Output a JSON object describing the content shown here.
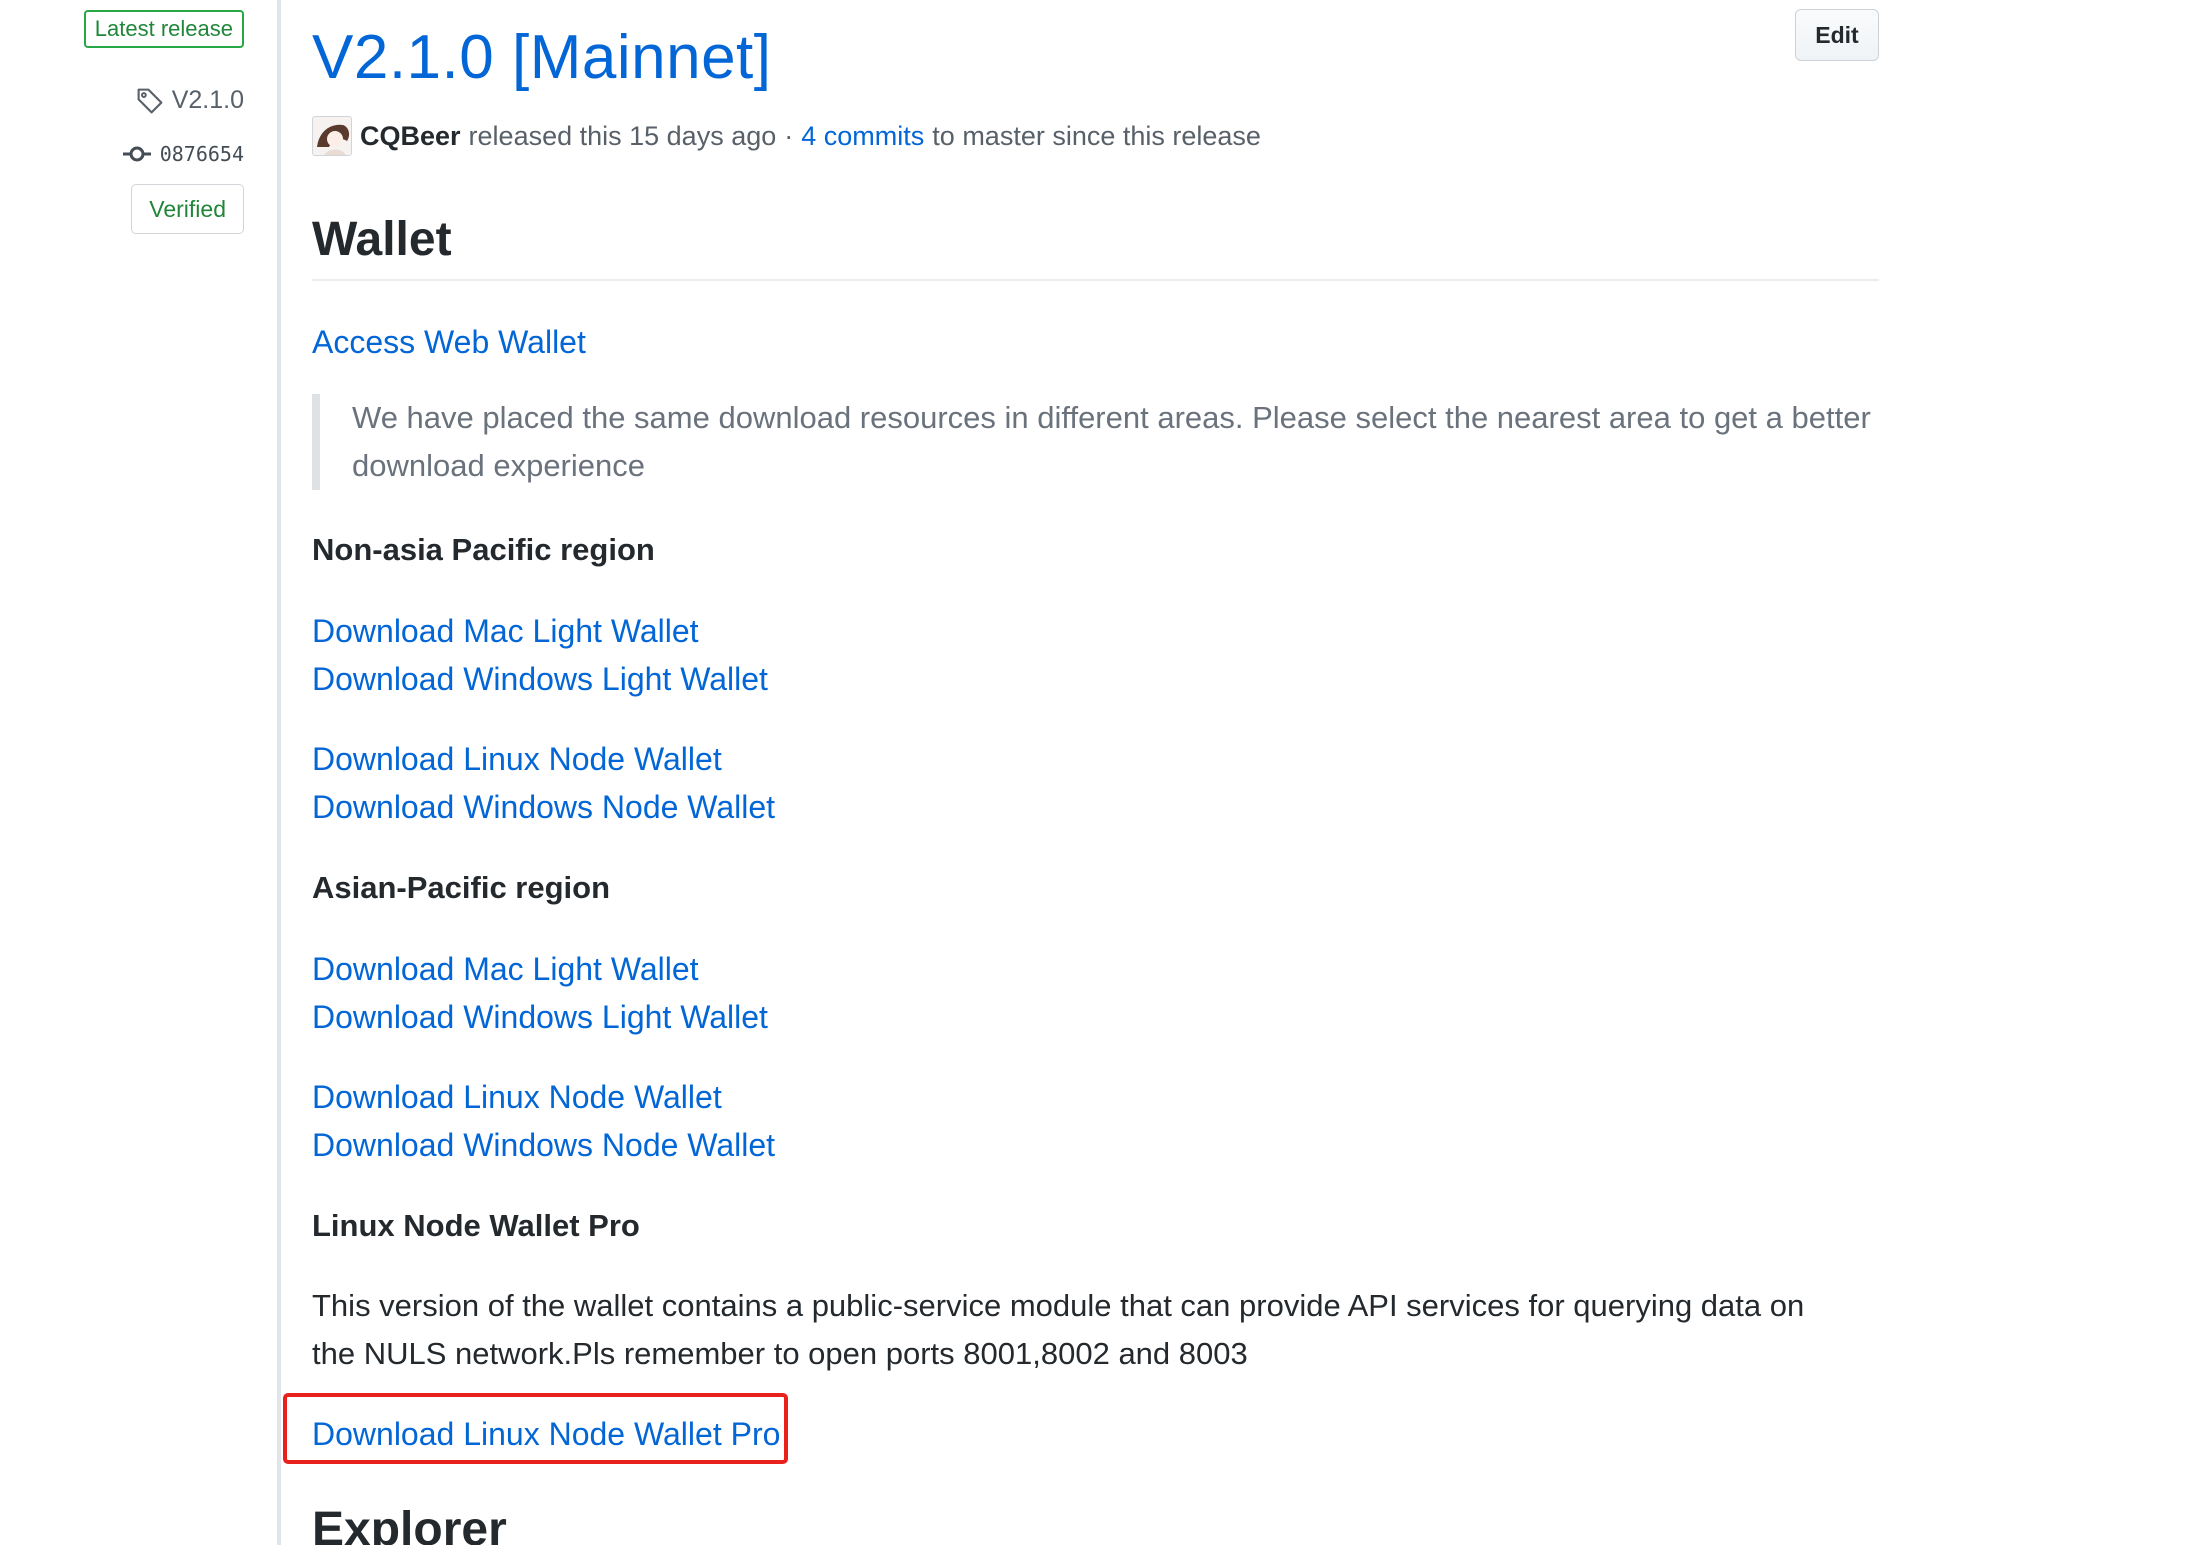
{
  "sidebar": {
    "latest_badge": "Latest release",
    "tag": "V2.1.0",
    "commit": "0876654",
    "verified": "Verified"
  },
  "release": {
    "title": "V2.1.0 [Mainnet]",
    "edit_label": "Edit",
    "author": "CQBeer",
    "released_text": "released this 15 days ago",
    "separator": "·",
    "commits_link": "4 commits",
    "commits_suffix": "to master since this release"
  },
  "body": {
    "wallet_heading": "Wallet",
    "access_web_wallet": "Access Web Wallet",
    "quote": "We have placed the same download resources in different areas. Please select the nearest area to get a better download experience",
    "non_asia": {
      "heading": "Non-asia Pacific region",
      "links": [
        "Download Mac Light Wallet",
        "Download Windows Light Wallet",
        "Download Linux Node Wallet",
        "Download Windows Node Wallet"
      ]
    },
    "asia": {
      "heading": "Asian-Pacific region",
      "links": [
        "Download Mac Light Wallet",
        "Download Windows Light Wallet",
        "Download Linux Node Wallet",
        "Download Windows Node Wallet"
      ]
    },
    "pro": {
      "heading": "Linux Node Wallet Pro",
      "description_line1": "This version of the wallet contains a public-service module that can provide API services for querying data on",
      "description_line2": "the NULS network.Pls remember to open ports 8001,8002 and 8003",
      "download_link": "Download Linux Node Wallet Pro"
    },
    "explorer_heading": "Explorer"
  },
  "colors": {
    "link": "#0366d6",
    "highlight_border": "#e8211d",
    "verified_green": "#22863a"
  }
}
